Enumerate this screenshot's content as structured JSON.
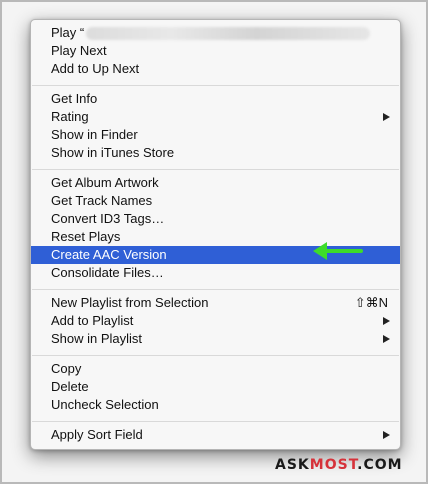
{
  "menu": {
    "groups": [
      {
        "items": [
          {
            "label": "Play “",
            "obscured": true
          },
          {
            "label": "Play Next"
          },
          {
            "label": "Add to Up Next"
          }
        ]
      },
      {
        "items": [
          {
            "label": "Get Info"
          },
          {
            "label": "Rating",
            "submenu": true
          },
          {
            "label": "Show in Finder"
          },
          {
            "label": "Show in iTunes Store"
          }
        ]
      },
      {
        "items": [
          {
            "label": "Get Album Artwork"
          },
          {
            "label": "Get Track Names"
          },
          {
            "label": "Convert ID3 Tags…"
          },
          {
            "label": "Reset Plays"
          },
          {
            "label": "Create AAC Version",
            "highlighted": true
          },
          {
            "label": "Consolidate Files…"
          }
        ]
      },
      {
        "items": [
          {
            "label": "New Playlist from Selection",
            "shortcut": "⇧⌘N"
          },
          {
            "label": "Add to Playlist",
            "submenu": true
          },
          {
            "label": "Show in Playlist",
            "submenu": true
          }
        ]
      },
      {
        "items": [
          {
            "label": "Copy"
          },
          {
            "label": "Delete"
          },
          {
            "label": "Uncheck Selection"
          }
        ]
      },
      {
        "items": [
          {
            "label": "Apply Sort Field",
            "submenu": true
          }
        ]
      }
    ]
  },
  "colors": {
    "highlight": "#2f5fd6",
    "annotation_arrow": "#3ddc2a",
    "watermark_accent": "#d6323a"
  },
  "watermark": {
    "part1": "ASK",
    "part2": "MOST",
    "part3": ".COM"
  }
}
